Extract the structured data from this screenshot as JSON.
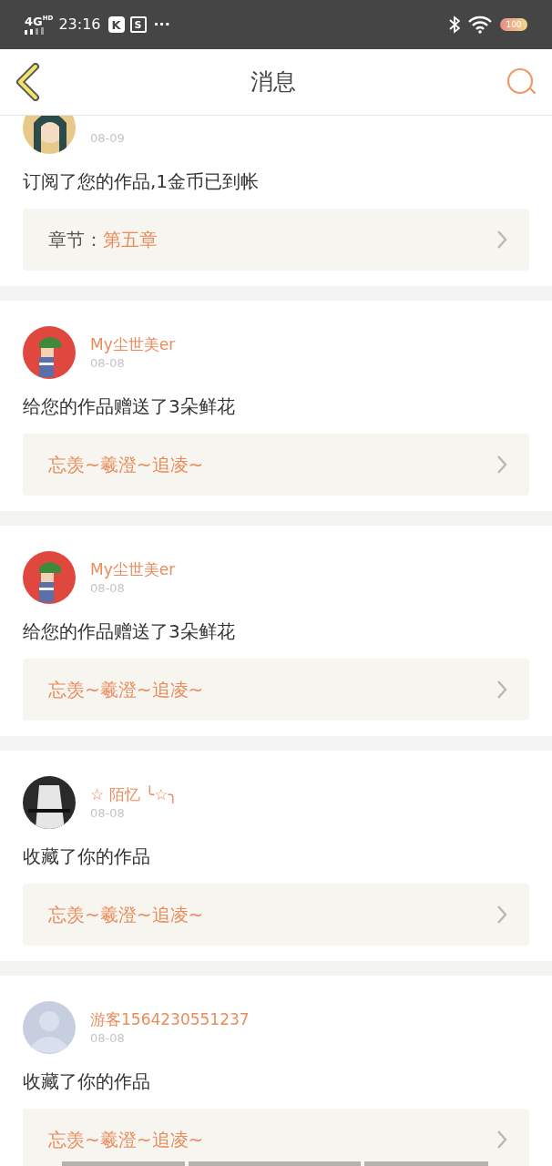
{
  "status_bar": {
    "network": "4G",
    "network_badge": "HD",
    "time": "23:16",
    "app_badges": [
      "K",
      "S"
    ],
    "more": "···",
    "battery": "100"
  },
  "header": {
    "title": "消息"
  },
  "messages": [
    {
      "date": "08-09",
      "text": "订阅了您的作品,1金币已到帐",
      "link": {
        "kind": "chapter",
        "label": "章节：",
        "title": "第五章"
      }
    },
    {
      "name": "My尘世美er",
      "date": "08-08",
      "text": "给您的作品赠送了3朵鲜花",
      "link": {
        "kind": "work",
        "title": "忘羡~羲澄~追凌~"
      }
    },
    {
      "name": "My尘世美er",
      "date": "08-08",
      "text": "给您的作品赠送了3朵鲜花",
      "link": {
        "kind": "work",
        "title": "忘羡~羲澄~追凌~"
      }
    },
    {
      "name": "☆ 陌忆 ╰☆╮",
      "date": "08-08",
      "text": "收藏了你的作品",
      "link": {
        "kind": "work",
        "title": "忘羡~羲澄~追凌~"
      }
    },
    {
      "avatar": {
        "kind": "placeholder"
      },
      "name": "游客1564230551237",
      "date": "08-08",
      "text": "收藏了你的作品",
      "link": {
        "kind": "work",
        "title": "忘羡~羲澄~追凌~"
      }
    }
  ]
}
